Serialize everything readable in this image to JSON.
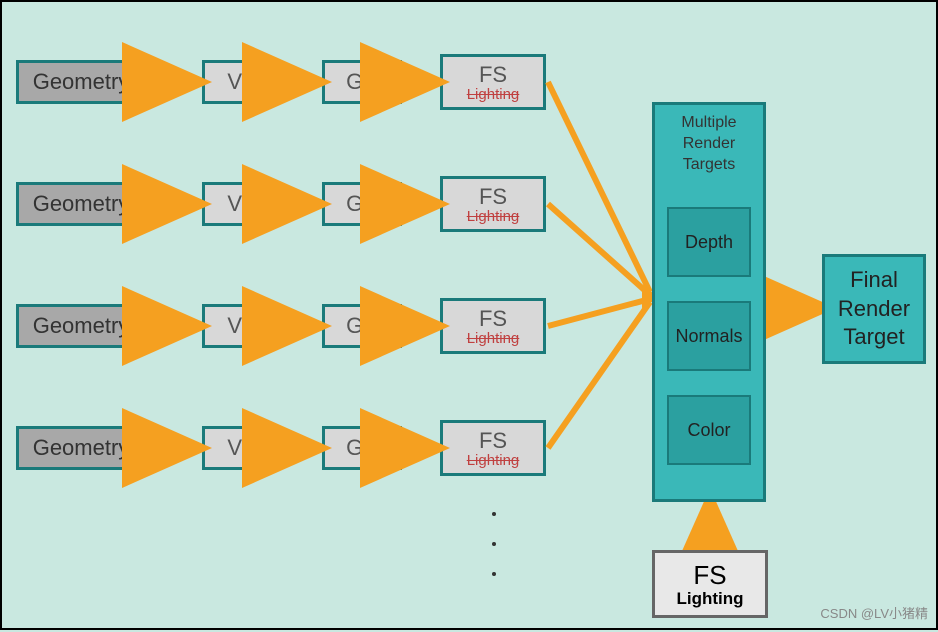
{
  "rows": [
    {
      "geom": "Geometry",
      "vs": "VS",
      "gs": "GS",
      "fs": "FS",
      "fs_sub": "Lighting"
    },
    {
      "geom": "Geometry",
      "vs": "VS",
      "gs": "GS",
      "fs": "FS",
      "fs_sub": "Lighting"
    },
    {
      "geom": "Geometry",
      "vs": "VS",
      "gs": "GS",
      "fs": "FS",
      "fs_sub": "Lighting"
    },
    {
      "geom": "Geometry",
      "vs": "VS",
      "gs": "GS",
      "fs": "FS",
      "fs_sub": "Lighting"
    }
  ],
  "mrt": {
    "title": "Multiple\nRender\nTargets",
    "items": [
      "Depth",
      "Normals",
      "Color"
    ]
  },
  "final": "Final\nRender\nTarget",
  "fs_light": {
    "title": "FS",
    "sub": "Lighting"
  },
  "watermark": "CSDN @LV小猪精",
  "colors": {
    "bg": "#c9e8e0",
    "teal": "#3ab8b8",
    "border": "#1a7a7a",
    "arrow": "#f5a020"
  }
}
